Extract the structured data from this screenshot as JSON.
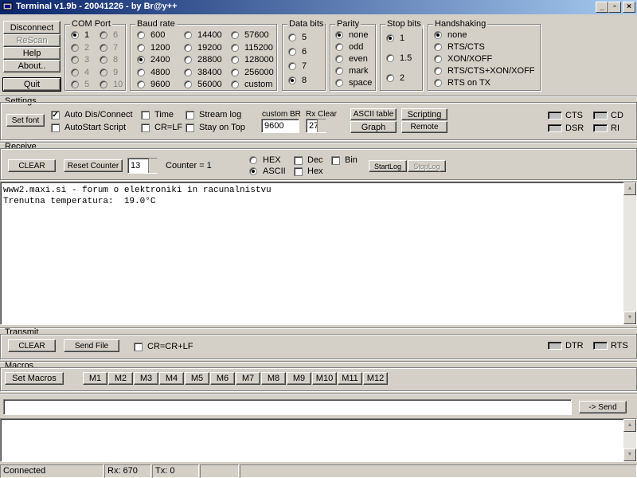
{
  "window": {
    "title": "Terminal v1.9b - 20041226 - by Br@y++"
  },
  "left_buttons": {
    "disconnect": "Disconnect",
    "rescan": "ReScan",
    "help": "Help",
    "about": "About..",
    "quit": "Quit"
  },
  "com_port": {
    "caption": "COM Port",
    "options": [
      "1",
      "2",
      "3",
      "4",
      "5",
      "6",
      "7",
      "8",
      "9",
      "10"
    ],
    "selected": "1"
  },
  "baudrate": {
    "caption": "Baud rate",
    "options": [
      "600",
      "1200",
      "2400",
      "4800",
      "9600",
      "14400",
      "19200",
      "28800",
      "38400",
      "56000",
      "57600",
      "115200",
      "128000",
      "256000",
      "custom"
    ],
    "selected": "2400"
  },
  "data_bits": {
    "caption": "Data bits",
    "options": [
      "5",
      "6",
      "7",
      "8"
    ],
    "selected": "8"
  },
  "parity": {
    "caption": "Parity",
    "options": [
      "none",
      "odd",
      "even",
      "mark",
      "space"
    ],
    "selected": "none"
  },
  "stop_bits": {
    "caption": "Stop bits",
    "options": [
      "1",
      "1.5",
      "2"
    ],
    "selected": "1"
  },
  "handshaking": {
    "caption": "Handshaking",
    "options": [
      "none",
      "RTS/CTS",
      "XON/XOFF",
      "RTS/CTS+XON/XOFF",
      "RTS on TX"
    ],
    "selected": "none"
  },
  "settings": {
    "caption": "Settings",
    "set_font": "Set font",
    "auto_dis_connect": "Auto Dis/Connect",
    "autostart_script": "AutoStart Script",
    "time": "Time",
    "cr_lf": "CR=LF",
    "stream_log": "Stream log",
    "stay_on_top": "Stay on Top",
    "custom_br_label": "custom BR",
    "custom_br_value": "9600",
    "rx_clear_label": "Rx Clear",
    "rx_clear_value": "27",
    "ascii_table": "ASCII table",
    "graph": "Graph",
    "scripting": "Scripting",
    "remote": "Remote",
    "cts": "CTS",
    "dsr": "DSR",
    "cd": "CD",
    "ri": "RI"
  },
  "receive": {
    "caption": "Receive",
    "clear": "CLEAR",
    "reset_counter": "Reset Counter",
    "counter_value": "13",
    "counter_label": "Counter = 1",
    "hex": "HEX",
    "ascii": "ASCII",
    "dec": "Dec",
    "hex_check": "Hex",
    "bin": "Bin",
    "start_log": "StartLog",
    "stop_log": "StopLog",
    "lines": [
      "www2.maxi.si - forum o elektroniki in racunalnistvu",
      "Trenutna temperatura:  19.0°C"
    ]
  },
  "transmit": {
    "caption": "Transmit",
    "clear": "CLEAR",
    "send_file": "Send File",
    "cr_crlf": "CR=CR+LF",
    "dtr": "DTR",
    "rts": "RTS"
  },
  "macros": {
    "caption": "Macros",
    "set_macros": "Set Macros",
    "buttons": [
      "M1",
      "M2",
      "M3",
      "M4",
      "M5",
      "M6",
      "M7",
      "M8",
      "M9",
      "M10",
      "M11",
      "M12"
    ]
  },
  "send": {
    "input_value": "",
    "button": "-> Send"
  },
  "statusbar": {
    "state": "Connected",
    "rx": "Rx: 670",
    "tx": "Tx: 0"
  }
}
